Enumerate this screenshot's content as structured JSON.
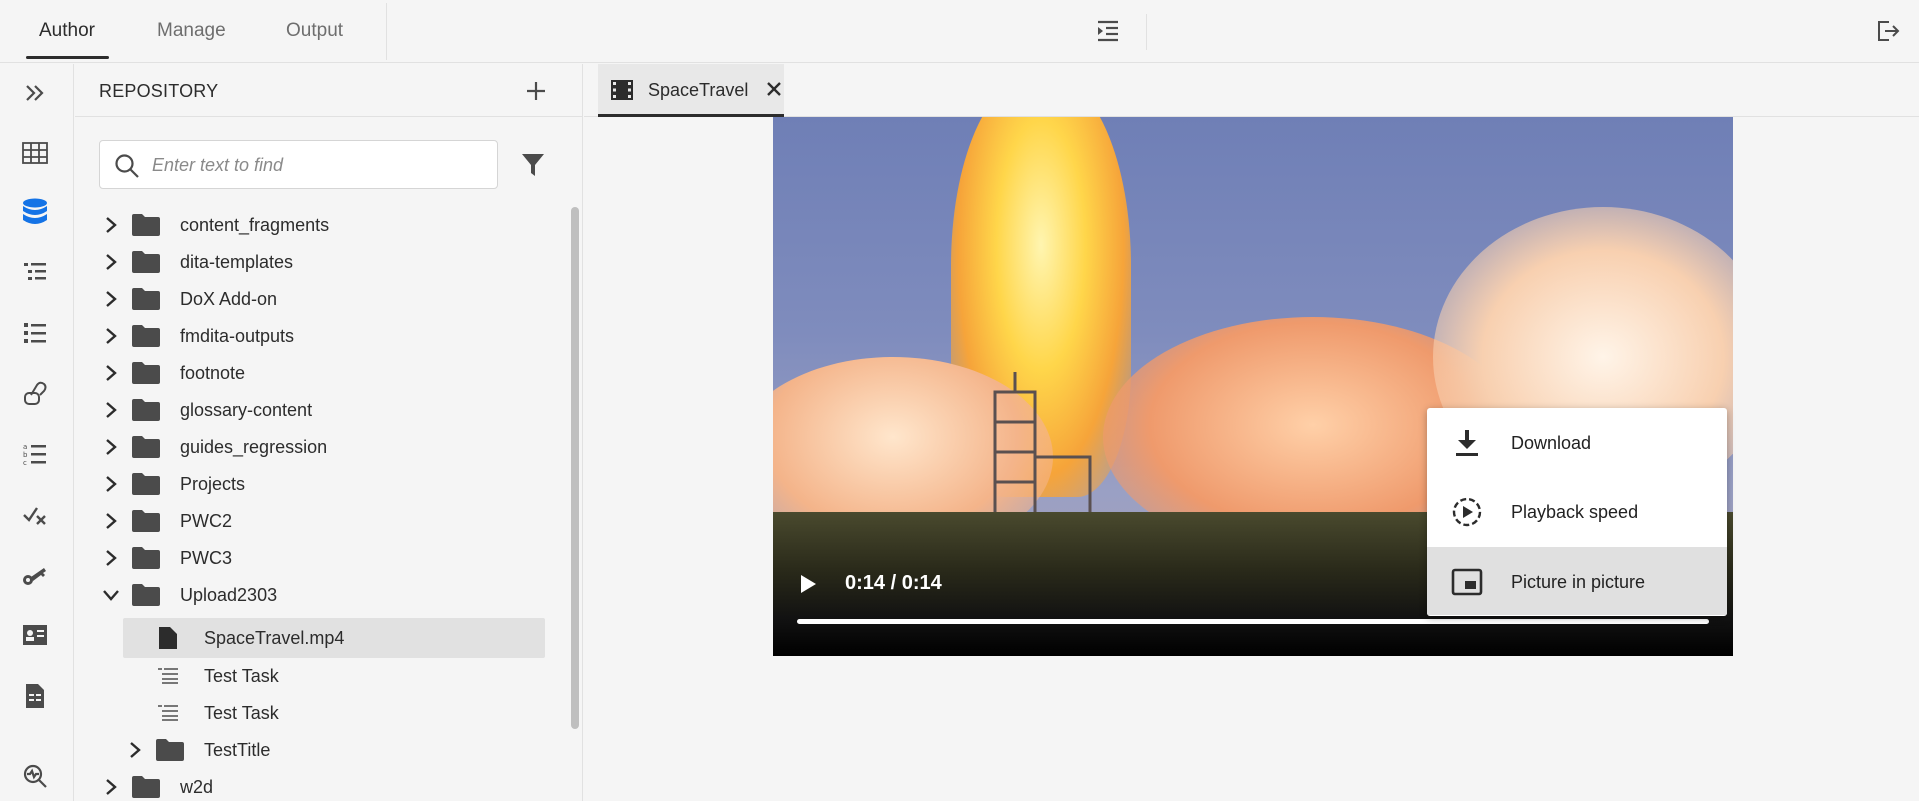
{
  "top_nav": {
    "tabs": [
      {
        "label": "Author",
        "active": true
      },
      {
        "label": "Manage",
        "active": false
      },
      {
        "label": "Output",
        "active": false
      }
    ],
    "icons": [
      "indent-icon",
      "exit-icon"
    ]
  },
  "rail": {
    "icons": [
      "expand-icon",
      "grid-icon",
      "database-icon",
      "outline-list-icon",
      "bulleted-list-icon",
      "links-icon",
      "numbered-list-icon",
      "review-check-icon",
      "key-icon",
      "id-card-icon",
      "file-report-icon",
      "search-magnify-icon"
    ],
    "active_index": 2
  },
  "repository": {
    "title": "REPOSITORY",
    "search": {
      "placeholder": "Enter text to find",
      "value": ""
    },
    "tree": [
      {
        "label": "content_fragments",
        "type": "folder",
        "level": 0,
        "expanded": false
      },
      {
        "label": "dita-templates",
        "type": "folder",
        "level": 0,
        "expanded": false
      },
      {
        "label": "DoX Add-on",
        "type": "folder",
        "level": 0,
        "expanded": false
      },
      {
        "label": "fmdita-outputs",
        "type": "folder",
        "level": 0,
        "expanded": false
      },
      {
        "label": "footnote",
        "type": "folder",
        "level": 0,
        "expanded": false
      },
      {
        "label": "glossary-content",
        "type": "folder",
        "level": 0,
        "expanded": false
      },
      {
        "label": "guides_regression",
        "type": "folder",
        "level": 0,
        "expanded": false
      },
      {
        "label": "Projects",
        "type": "folder",
        "level": 0,
        "expanded": false
      },
      {
        "label": "PWC2",
        "type": "folder",
        "level": 0,
        "expanded": false
      },
      {
        "label": "PWC3",
        "type": "folder",
        "level": 0,
        "expanded": false
      },
      {
        "label": "Upload2303",
        "type": "folder",
        "level": 0,
        "expanded": true
      },
      {
        "label": "SpaceTravel.mp4",
        "type": "file",
        "level": 1,
        "selected": true
      },
      {
        "label": "Test Task",
        "type": "topic",
        "level": 1
      },
      {
        "label": "Test Task",
        "type": "topic",
        "level": 1
      },
      {
        "label": "TestTitle",
        "type": "folder",
        "level": 1,
        "expanded": false
      },
      {
        "label": "w2d",
        "type": "folder",
        "level": 0,
        "expanded": false
      }
    ]
  },
  "editor": {
    "tab": {
      "label": "SpaceTravel",
      "icon": "film-icon"
    },
    "video": {
      "time": "0:14 / 0:14",
      "progress": 1.0
    },
    "context_menu": [
      {
        "label": "Download",
        "icon": "download-icon",
        "highlighted": false
      },
      {
        "label": "Playback speed",
        "icon": "playback-speed-icon",
        "highlighted": false
      },
      {
        "label": "Picture in picture",
        "icon": "picture-in-picture-icon",
        "highlighted": true
      }
    ]
  },
  "colors": {
    "background": "#f5f5f5",
    "accent_blue": "#1473e6",
    "text": "#2c2c2c"
  }
}
